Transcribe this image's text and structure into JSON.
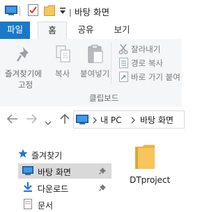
{
  "window": {
    "title": "바탕 화면"
  },
  "ribbon_tabs": [
    "파일",
    "홈",
    "공유",
    "보기"
  ],
  "ribbon": {
    "pin_label_line1": "즐겨찾기에",
    "pin_label_line2": "고정",
    "copy_label": "복사",
    "paste_label": "붙여넣기",
    "cut_label": "잘라내기",
    "copy_path_label": "경로 복사",
    "paste_shortcut_label": "바로 가기 붙여",
    "group_label": "클립보드"
  },
  "address": {
    "crumbs": [
      "내 PC",
      "바탕 화면"
    ]
  },
  "nav_pane": {
    "quick_access": "즐겨찾기",
    "items": [
      "바탕 화면",
      "다운로드",
      "문서"
    ]
  },
  "content": {
    "items": [
      {
        "name": "DTproject",
        "type": "folder"
      }
    ]
  },
  "colors": {
    "file_tab": "#1979ca",
    "folder": "#f5c65b",
    "accent_blue": "#1e7ad4"
  }
}
